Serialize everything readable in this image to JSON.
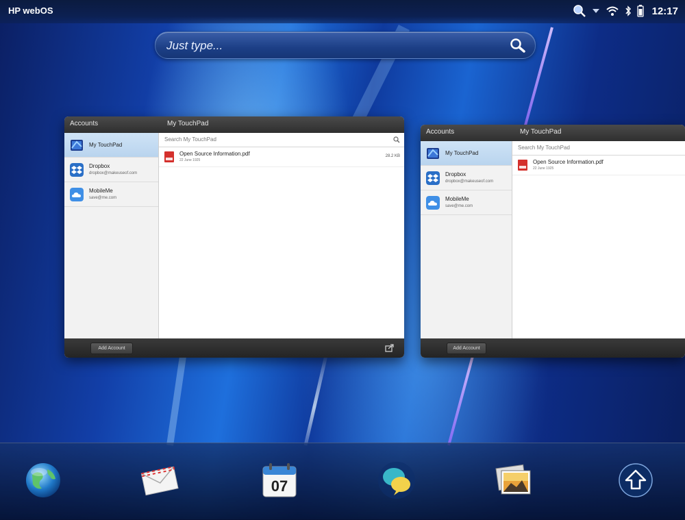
{
  "status_bar": {
    "device_name": "HP webOS",
    "time": "12:17",
    "icons": [
      "notification-search-icon",
      "dropdown-arrow-icon",
      "wifi-icon",
      "bluetooth-icon",
      "battery-icon"
    ]
  },
  "search": {
    "placeholder": "Just type..."
  },
  "cards": [
    {
      "accounts_header": "Accounts",
      "title": "My TouchPad",
      "accounts": [
        {
          "name": "My TouchPad",
          "email": "",
          "icon": "touchpad-icon",
          "selected": true
        },
        {
          "name": "Dropbox",
          "email": "dropbox@makeuseof.com",
          "icon": "dropbox-icon",
          "selected": false
        },
        {
          "name": "MobileMe",
          "email": "save@me.com",
          "icon": "mobileme-cloud-icon",
          "selected": false
        }
      ],
      "search_placeholder": "Search My TouchPad",
      "files": [
        {
          "name": "Open Source Information.pdf",
          "date": "22 June 1925",
          "size": "28.2 KB"
        }
      ],
      "add_account_label": "Add Account"
    },
    {
      "accounts_header": "Accounts",
      "title": "My TouchPad",
      "accounts": [
        {
          "name": "My TouchPad",
          "email": "",
          "icon": "touchpad-icon",
          "selected": true
        },
        {
          "name": "Dropbox",
          "email": "dropbox@makeuseof.com",
          "icon": "dropbox-icon",
          "selected": false
        },
        {
          "name": "MobileMe",
          "email": "save@me.com",
          "icon": "mobileme-cloud-icon",
          "selected": false
        }
      ],
      "search_placeholder": "Search My TouchPad",
      "files": [
        {
          "name": "Open Source Information.pdf",
          "date": "22 June 1925",
          "size": ""
        }
      ],
      "add_account_label": "Add Account"
    }
  ],
  "dock": [
    {
      "app": "web-browser",
      "icon": "globe-icon"
    },
    {
      "app": "email",
      "icon": "envelope-icon"
    },
    {
      "app": "calendar",
      "icon": "calendar-icon",
      "label": "07"
    },
    {
      "app": "messaging",
      "icon": "chat-bubbles-icon"
    },
    {
      "app": "photos",
      "icon": "photos-icon"
    },
    {
      "app": "launcher",
      "icon": "up-arrow-icon"
    }
  ],
  "colors": {
    "wallpaper_primary": "#1e6fdc",
    "streak_purple": "#b88cff",
    "card_header": "#3a3a3a",
    "selected_account": "#cfe3f6"
  }
}
